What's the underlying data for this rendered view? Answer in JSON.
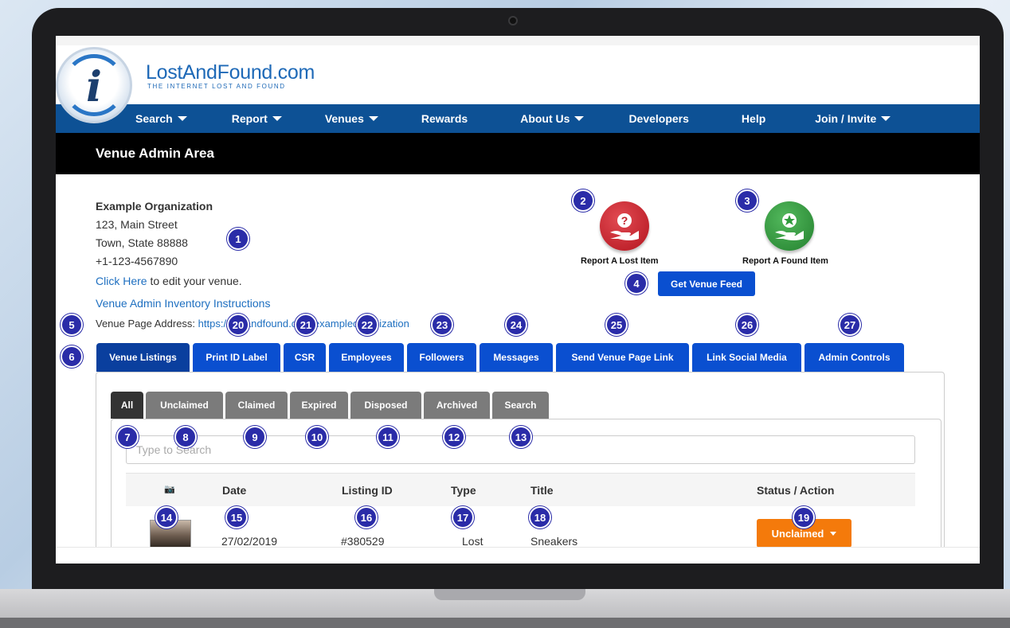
{
  "site": {
    "brand": "LostAndFound.com",
    "tagline": "THE INTERNET LOST AND FOUND",
    "logo_letter": "i"
  },
  "nav": [
    {
      "label": "Search",
      "dropdown": true
    },
    {
      "label": "Report",
      "dropdown": true
    },
    {
      "label": "Venues",
      "dropdown": true
    },
    {
      "label": "Rewards",
      "dropdown": false
    },
    {
      "label": "About Us",
      "dropdown": true
    },
    {
      "label": "Developers",
      "dropdown": false
    },
    {
      "label": "Help",
      "dropdown": false
    },
    {
      "label": "Join / Invite",
      "dropdown": true
    }
  ],
  "header": {
    "title": "Venue Admin Area"
  },
  "venue": {
    "name": "Example Organization",
    "address1": "123, Main Street",
    "address2": "Town, State 88888",
    "phone": "+1-123-4567890",
    "edit_link": "Click Here",
    "edit_text": " to edit your venue.",
    "instructions": "Venue Admin Inventory Instructions",
    "page_address_label": "Venue Page Address: ",
    "page_address_url": "https://lostandfound.com/exampleorganization"
  },
  "actions": {
    "report_lost": "Report A Lost Item",
    "report_found": "Report A Found Item",
    "feed_button": "Get Venue Feed"
  },
  "tabs": [
    "Venue Listings",
    "Print ID Label",
    "CSR",
    "Employees",
    "Followers",
    "Messages",
    "Send Venue Page Link",
    "Link Social Media",
    "Admin Controls"
  ],
  "subtabs": [
    "All",
    "Unclaimed",
    "Claimed",
    "Expired",
    "Disposed",
    "Archived",
    "Search"
  ],
  "search": {
    "placeholder": "Type to Search"
  },
  "table": {
    "headers": {
      "photo": "📷",
      "date": "Date",
      "listing_id": "Listing ID",
      "type": "Type",
      "title": "Title",
      "status": "Status / Action"
    },
    "rows": [
      {
        "date": "27/02/2019",
        "listing_id": "#380529",
        "type": "Lost",
        "title": "Sneakers",
        "status": "Unclaimed"
      }
    ]
  },
  "badges": [
    "1",
    "2",
    "3",
    "4",
    "5",
    "6",
    "7",
    "8",
    "9",
    "10",
    "11",
    "12",
    "13",
    "14",
    "15",
    "16",
    "17",
    "18",
    "19",
    "20",
    "21",
    "22",
    "23",
    "24",
    "25",
    "26",
    "27"
  ],
  "colors": {
    "nav": "#0d5195",
    "tab": "#0a4fd0",
    "status": "#f47a0b",
    "badge": "#2a2ca8",
    "lost": "#c0202a",
    "found": "#2f9a3c"
  }
}
